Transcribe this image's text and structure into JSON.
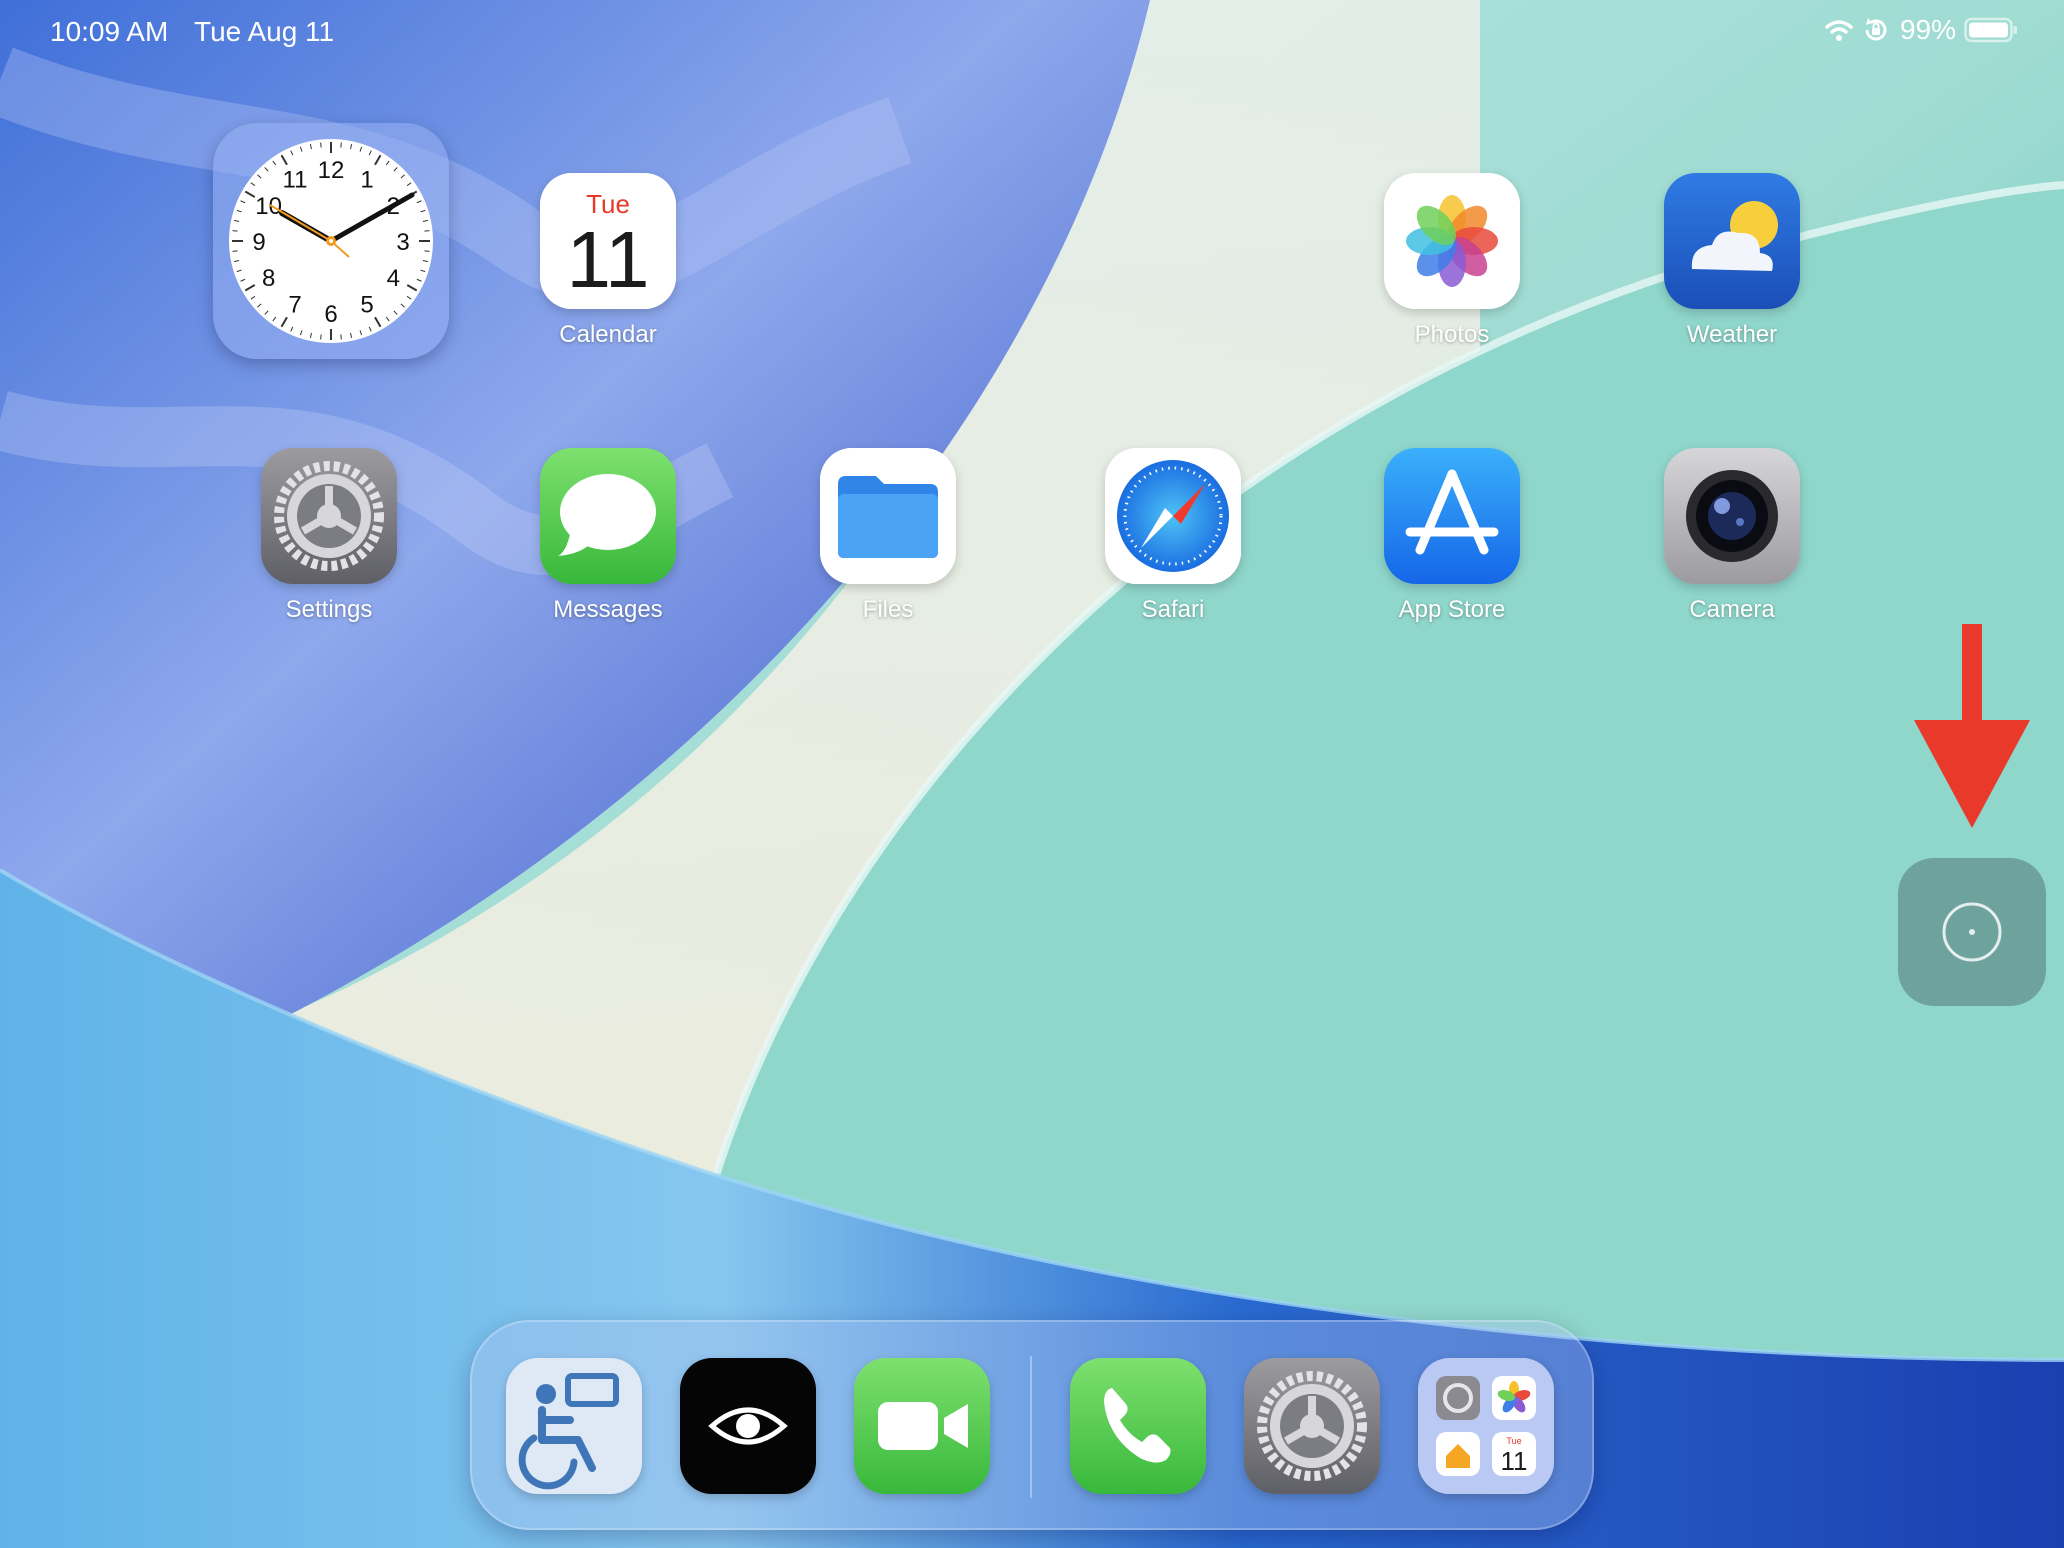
{
  "status_bar": {
    "time": "10:09 AM",
    "date": "Tue Aug 11",
    "battery_percent": "99%",
    "icons": [
      "wifi-icon",
      "orientation-lock-icon",
      "battery-icon"
    ]
  },
  "clock_widget": {
    "hour_numbers": [
      "12",
      "1",
      "2",
      "3",
      "4",
      "5",
      "6",
      "7",
      "8",
      "9",
      "10",
      "11"
    ]
  },
  "apps": [
    {
      "label": "Calendar",
      "icon": "calendar-icon",
      "day": "Tue",
      "date": "11"
    },
    {
      "label": "Photos",
      "icon": "photos-icon"
    },
    {
      "label": "Weather",
      "icon": "weather-icon"
    },
    {
      "label": "Settings",
      "icon": "settings-gear-icon"
    },
    {
      "label": "Messages",
      "icon": "messages-bubble-icon"
    },
    {
      "label": "Files",
      "icon": "files-folder-icon"
    },
    {
      "label": "Safari",
      "icon": "safari-compass-icon"
    },
    {
      "label": "App Store",
      "icon": "app-store-icon"
    },
    {
      "label": "Camera",
      "icon": "camera-lens-icon"
    }
  ],
  "dock": {
    "items": [
      {
        "icon": "accessibility-wheelchair-icon"
      },
      {
        "icon": "eye-icon"
      },
      {
        "icon": "facetime-camera-icon"
      },
      {
        "icon": "phone-icon"
      },
      {
        "icon": "settings-gear-icon"
      },
      {
        "icon": "app-library-icon",
        "mini_calendar": {
          "day": "Tue",
          "date": "11"
        }
      }
    ]
  },
  "assistive_touch": {
    "icon": "assistive-touch-icon"
  },
  "annotation": {
    "icon": "red-arrow-down-icon",
    "color": "#e8392a"
  },
  "colors": {
    "calendar_red": "#e8392a",
    "messages_green": "#5fd15f",
    "appstore_blue": "#1f8ef5"
  }
}
